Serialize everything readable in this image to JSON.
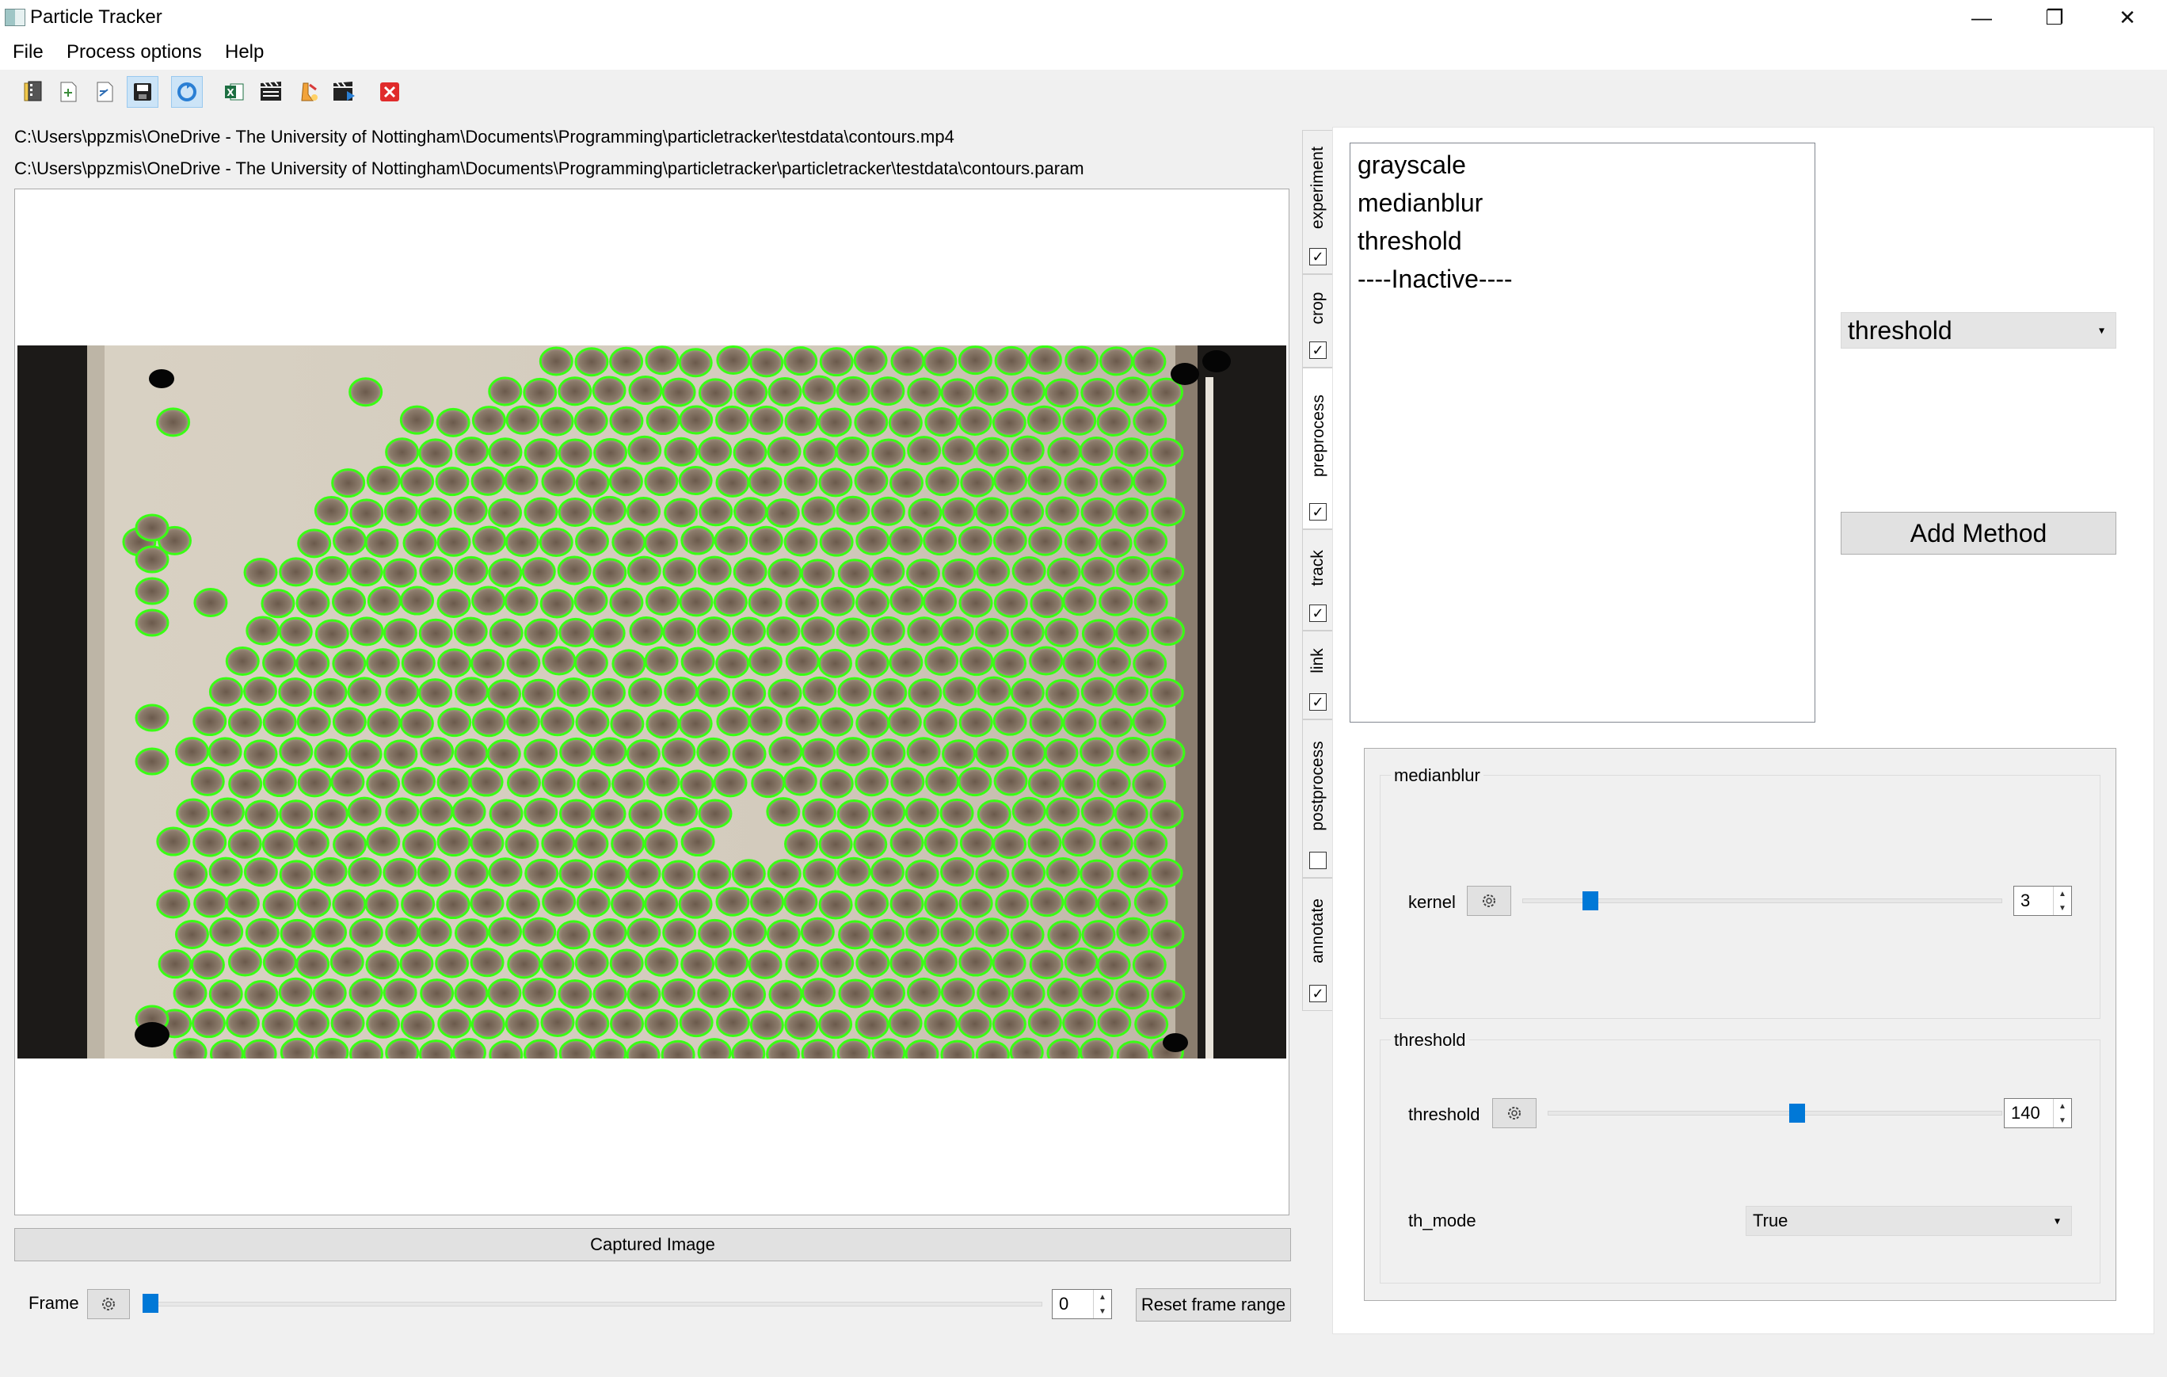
{
  "window": {
    "title": "Particle Tracker",
    "controls": {
      "minimize": "—",
      "restore": "❐",
      "close": "✕"
    }
  },
  "menu": {
    "items": [
      "File",
      "Process options",
      "Help"
    ]
  },
  "toolbar": {
    "icons": [
      "open-video-icon",
      "open-settings-icon",
      "save-settings-icon",
      "save-current-icon",
      "live-update-icon",
      "export-excel-icon",
      "process-video-icon",
      "process-part-icon",
      "process-video-play-icon",
      "close-icon"
    ],
    "active": [
      "save-current-icon",
      "live-update-icon"
    ]
  },
  "paths": {
    "video": "C:\\Users\\ppzmis\\OneDrive - The University of Nottingham\\Documents\\Programming\\particletracker\\testdata\\contours.mp4",
    "params": "C:\\Users\\ppzmis\\OneDrive - The University of Nottingham\\Documents\\Programming\\particletracker\\particletracker\\testdata\\contours.param"
  },
  "viewer": {
    "caption": "Captured Image",
    "detection_color": "#39ff14"
  },
  "frame": {
    "label": "Frame",
    "value": "0",
    "slider_fraction": 0.0,
    "reset_label": "Reset frame range"
  },
  "tabs": [
    {
      "label": "experiment",
      "checked": true
    },
    {
      "label": "crop",
      "checked": true
    },
    {
      "label": "preprocess",
      "checked": true,
      "active": true
    },
    {
      "label": "track",
      "checked": true
    },
    {
      "label": "link",
      "checked": true
    },
    {
      "label": "postprocess",
      "checked": false
    },
    {
      "label": "annotate",
      "checked": true
    }
  ],
  "preprocess": {
    "methods": [
      "grayscale",
      "medianblur",
      "threshold",
      "----Inactive----"
    ],
    "method_select": "threshold",
    "add_button": "Add Method",
    "groups": {
      "medianblur": {
        "title": "medianblur",
        "param": "kernel",
        "value": "3",
        "slider_fraction": 0.13
      },
      "threshold": {
        "title": "threshold",
        "param": "threshold",
        "value": "140",
        "slider_fraction": 0.55,
        "mode_label": "th_mode",
        "mode_value": "True"
      }
    }
  },
  "accent_color": "#0078d7"
}
